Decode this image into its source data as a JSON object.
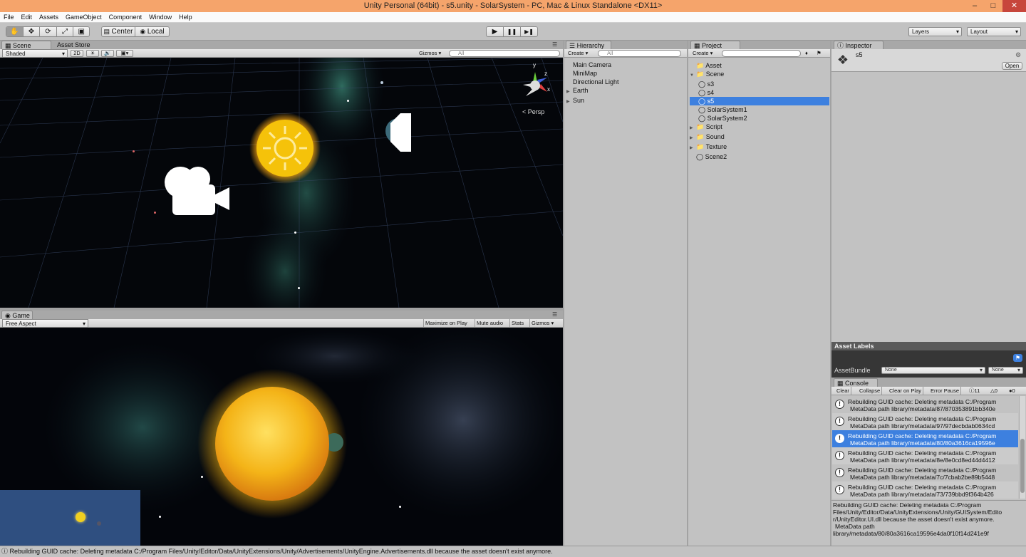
{
  "window": {
    "title": "Unity Personal (64bit) - s5.unity - SolarSystem - PC, Mac & Linux Standalone <DX11>",
    "minimize": "–",
    "maximize": "□",
    "close": "✕"
  },
  "menu": [
    "File",
    "Edit",
    "Assets",
    "GameObject",
    "Component",
    "Window",
    "Help"
  ],
  "toolbar": {
    "tools": [
      "hand-icon",
      "move-icon",
      "rotate-icon",
      "scale-icon",
      "rect-icon"
    ],
    "pivot": "Center",
    "space": "Local",
    "play": "▶",
    "pause": "❚❚",
    "step": "▶❚",
    "layers": "Layers",
    "layout": "Layout"
  },
  "scene": {
    "tab_scene": "Scene",
    "tab_store": "Asset Store",
    "shading": "Shaded",
    "mode_2d": "2D",
    "gizmos": "Gizmos",
    "search_placeholder": "All",
    "persp": "Persp",
    "axis_y": "y",
    "axis_x": "x",
    "axis_z": "z"
  },
  "game": {
    "tab": "Game",
    "aspect": "Free Aspect",
    "buttons": [
      "Maximize on Play",
      "Mute audio",
      "Stats",
      "Gizmos"
    ]
  },
  "hierarchy": {
    "tab": "Hierarchy",
    "create": "Create",
    "search_placeholder": "All",
    "items": [
      {
        "label": "Main Camera",
        "arrow": ""
      },
      {
        "label": "MiniMap",
        "arrow": ""
      },
      {
        "label": "Directional Light",
        "arrow": ""
      },
      {
        "label": "Earth",
        "arrow": "▶"
      },
      {
        "label": "Sun",
        "arrow": "▶"
      }
    ]
  },
  "project": {
    "tab": "Project",
    "create": "Create",
    "items": [
      {
        "label": "Asset",
        "type": "folder",
        "arrow": ""
      },
      {
        "label": "Scene",
        "type": "folder",
        "arrow": "▼"
      },
      {
        "label": "s3",
        "type": "scene",
        "arrow": ""
      },
      {
        "label": "s4",
        "type": "scene",
        "arrow": ""
      },
      {
        "label": "s5",
        "type": "scene",
        "arrow": "",
        "selected": true
      },
      {
        "label": "SolarSystem1",
        "type": "scene",
        "arrow": ""
      },
      {
        "label": "SolarSystem2",
        "type": "scene",
        "arrow": ""
      },
      {
        "label": "Script",
        "type": "folder",
        "arrow": "▶"
      },
      {
        "label": "Sound",
        "type": "folder",
        "arrow": "▶"
      },
      {
        "label": "Texture",
        "type": "folder",
        "arrow": "▶"
      },
      {
        "label": "Scene2",
        "type": "scene",
        "arrow": ""
      }
    ]
  },
  "inspector": {
    "tab": "Inspector",
    "asset_name": "s5",
    "open": "Open",
    "asset_labels": "Asset Labels",
    "asset_bundle": "AssetBundle",
    "bundle_value": "None",
    "bundle_variant": "None"
  },
  "console": {
    "tab": "Console",
    "buttons": [
      "Clear",
      "Collapse",
      "Clear on Play",
      "Error Pause"
    ],
    "count_info": "11",
    "count_warn": "0",
    "count_error": "0",
    "entries": [
      {
        "line1": "Rebuilding GUID cache: Deleting metadata C:/Program",
        "line2": "MetaData path library/metadata/87/870353891bb340e"
      },
      {
        "line1": "Rebuilding GUID cache: Deleting metadata C:/Program",
        "line2": "MetaData path library/metadata/97/97decbdab0634cd"
      },
      {
        "line1": "Rebuilding GUID cache: Deleting metadata C:/Program",
        "line2": "MetaData path library/metadata/80/80a3616ca19596e"
      },
      {
        "line1": "Rebuilding GUID cache: Deleting metadata C:/Program",
        "line2": "MetaData path library/metadata/8e/8e0cd8ed44d4412"
      },
      {
        "line1": "Rebuilding GUID cache: Deleting metadata C:/Program",
        "line2": "MetaData path library/metadata/7c/7cbab2be89b5448"
      },
      {
        "line1": "Rebuilding GUID cache: Deleting metadata C:/Program",
        "line2": "MetaData path library/metadata/73/739bbd9f364b426"
      }
    ],
    "selected_index": 2,
    "detail": [
      "Rebuilding GUID cache: Deleting metadata C:/Program",
      "Files/Unity/Editor/Data/UnityExtensions/Unity/GUISystem/Edito",
      "r/UnityEditor.UI.dll because the asset doesn't exist anymore.",
      "MetaData path",
      "library/metadata/80/80a3616ca19596e4da0f10f14d241e9f"
    ]
  },
  "status": "Rebuilding GUID cache: Deleting metadata C:/Program Files/Unity/Editor/Data/UnityExtensions/Unity/Advertisements/UnityEngine.Advertisements.dll because the asset doesn't exist anymore.",
  "colors": {
    "title_bar": "#f5a46b",
    "selection": "#3d80df",
    "panel": "#c2c2c2",
    "minimap": "#2f4f80"
  }
}
